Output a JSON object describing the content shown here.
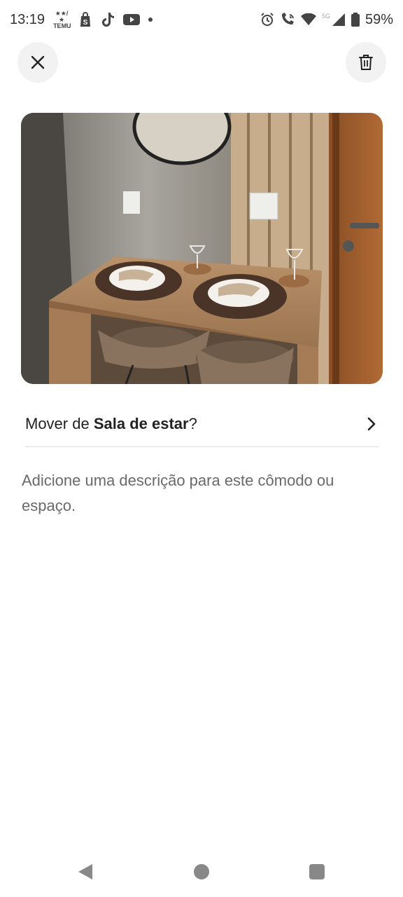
{
  "status_bar": {
    "time": "13:19",
    "temu_label_top": "★★/★",
    "temu_label": "TEMU",
    "network": "5G",
    "battery": "59%"
  },
  "header": {
    "close_icon": "close-icon",
    "delete_icon": "trash-icon"
  },
  "move": {
    "prefix": "Mover de ",
    "room": "Sala de estar",
    "suffix": "?"
  },
  "description_placeholder": "Adicione uma descrição para este cômodo ou espaço.",
  "colors": {
    "text_primary": "#222222",
    "text_secondary": "#6a6a6a",
    "button_bg": "#f2f2f2",
    "divider": "#dddddd"
  }
}
